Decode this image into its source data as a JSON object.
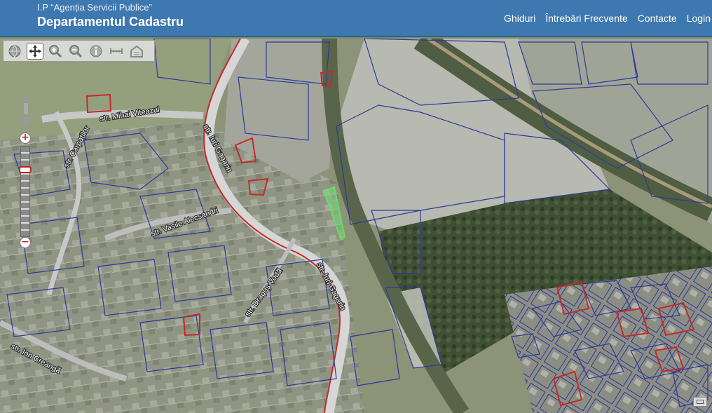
{
  "header": {
    "org": "I.P “Agenția Servicii Publice”",
    "title": "Departamentul Cadastru",
    "nav": [
      "Ghiduri",
      "Întrebări Frecvente",
      "Contacte",
      "Login"
    ]
  },
  "map": {
    "streets": {
      "mihai_viteazul": "str. Mihai Viteazul",
      "carpatilor": "str. Carpaților",
      "iuri_gagarin_1": "str. Iuri Gagarin",
      "vasile_alecsandri": "str. Vasile Alecsandri",
      "dragos_voda": "str. Dragoș Vodă",
      "iuri_gagarin_2": "str. Iuri Gagarin",
      "ion_creanga": "str. Ion Creangă"
    },
    "zoom": {
      "plus": "+",
      "minus": "−"
    }
  },
  "toolbar": {
    "tools": [
      "globe-icon",
      "pan-icon",
      "zoom-in-icon",
      "zoom-out-icon",
      "info-icon",
      "measure-icon",
      "building-icon"
    ]
  },
  "colors": {
    "header": "#3e78b0",
    "parcel_outline": "#2b3a9a",
    "highlight_red": "#c42a2a",
    "selected_green": "#66dd66",
    "road": "#c9c9c9"
  }
}
